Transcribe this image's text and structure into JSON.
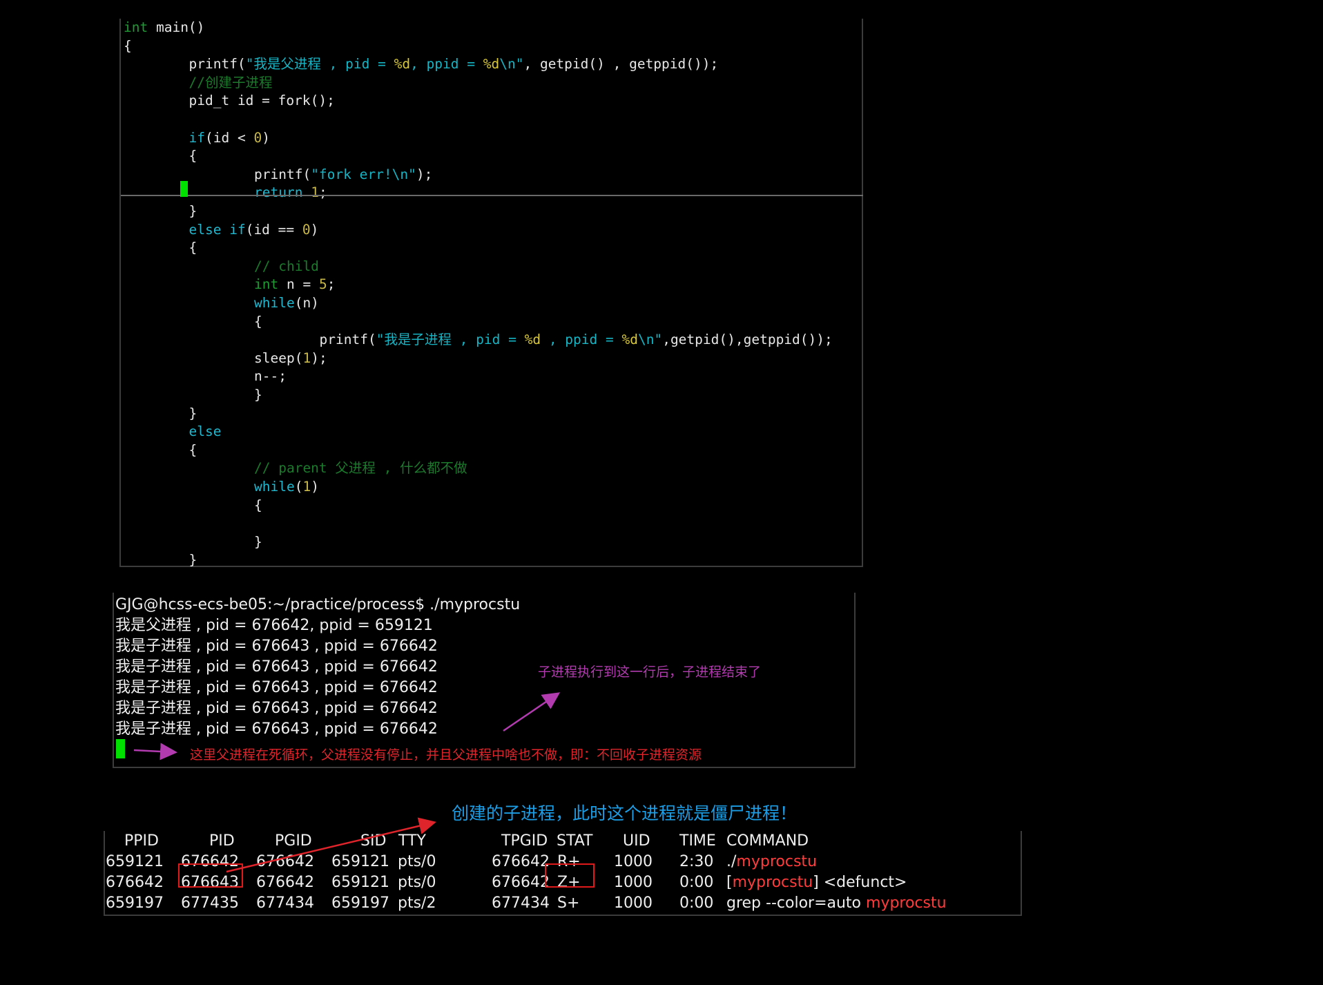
{
  "code": {
    "lines": [
      {
        "indent": 0,
        "tokens": [
          {
            "t": "int",
            "c": "ty"
          },
          {
            "t": " main()",
            "c": ""
          }
        ]
      },
      {
        "indent": 0,
        "tokens": [
          {
            "t": "{",
            "c": ""
          }
        ]
      },
      {
        "indent": 1,
        "tokens": [
          {
            "t": "printf(",
            "c": ""
          },
          {
            "t": "\"我是父进程 , pid = ",
            "c": "str"
          },
          {
            "t": "%d",
            "c": "fmt"
          },
          {
            "t": ", ppid = ",
            "c": "str"
          },
          {
            "t": "%d",
            "c": "fmt"
          },
          {
            "t": "\\n",
            "c": "str"
          },
          {
            "t": "\"",
            "c": "str"
          },
          {
            "t": ", getpid() , getppid());",
            "c": ""
          }
        ]
      },
      {
        "indent": 1,
        "tokens": [
          {
            "t": "//创建子进程",
            "c": "cmt"
          }
        ]
      },
      {
        "indent": 1,
        "tokens": [
          {
            "t": "pid_t id = fork();",
            "c": ""
          }
        ]
      },
      {
        "indent": 0,
        "tokens": []
      },
      {
        "indent": 1,
        "tokens": [
          {
            "t": "if",
            "c": "kw"
          },
          {
            "t": "(id < ",
            "c": ""
          },
          {
            "t": "0",
            "c": "num"
          },
          {
            "t": ")",
            "c": ""
          }
        ]
      },
      {
        "indent": 1,
        "tokens": [
          {
            "t": "{",
            "c": ""
          }
        ]
      },
      {
        "indent": 2,
        "tokens": [
          {
            "t": "printf(",
            "c": ""
          },
          {
            "t": "\"fork err!",
            "c": "str"
          },
          {
            "t": "\\n",
            "c": "str"
          },
          {
            "t": "\"",
            "c": "str"
          },
          {
            "t": ");",
            "c": ""
          }
        ]
      },
      {
        "indent": 2,
        "tokens": [
          {
            "t": "return",
            "c": "kw"
          },
          {
            "t": " ",
            "c": ""
          },
          {
            "t": "1",
            "c": "num"
          },
          {
            "t": ";",
            "c": ""
          }
        ]
      },
      {
        "indent": 1,
        "tokens": [
          {
            "t": "}",
            "c": ""
          }
        ]
      },
      {
        "indent": 1,
        "tokens": [
          {
            "t": "else",
            "c": "kw"
          },
          {
            "t": " ",
            "c": ""
          },
          {
            "t": "if",
            "c": "kw"
          },
          {
            "t": "(id == ",
            "c": ""
          },
          {
            "t": "0",
            "c": "num"
          },
          {
            "t": ")",
            "c": ""
          }
        ]
      },
      {
        "indent": 1,
        "tokens": [
          {
            "t": "{",
            "c": ""
          }
        ]
      },
      {
        "indent": 2,
        "tokens": [
          {
            "t": "// child",
            "c": "cmt"
          }
        ]
      },
      {
        "indent": 2,
        "tokens": [
          {
            "t": "int",
            "c": "ty"
          },
          {
            "t": " n = ",
            "c": ""
          },
          {
            "t": "5",
            "c": "num"
          },
          {
            "t": ";",
            "c": ""
          }
        ]
      },
      {
        "indent": 2,
        "tokens": [
          {
            "t": "while",
            "c": "kw"
          },
          {
            "t": "(n)",
            "c": ""
          }
        ]
      },
      {
        "indent": 2,
        "tokens": [
          {
            "t": "{",
            "c": ""
          }
        ]
      },
      {
        "indent": 3,
        "tokens": [
          {
            "t": "printf(",
            "c": ""
          },
          {
            "t": "\"我是子进程 , pid = ",
            "c": "str"
          },
          {
            "t": "%d",
            "c": "fmt"
          },
          {
            "t": " , ppid = ",
            "c": "str"
          },
          {
            "t": "%d",
            "c": "fmt"
          },
          {
            "t": "\\n",
            "c": "str"
          },
          {
            "t": "\"",
            "c": "str"
          },
          {
            "t": ",getpid(),getppid());",
            "c": ""
          }
        ]
      },
      {
        "indent": 2,
        "tokens": [
          {
            "t": "sleep(",
            "c": ""
          },
          {
            "t": "1",
            "c": "num"
          },
          {
            "t": ");",
            "c": ""
          }
        ]
      },
      {
        "indent": 2,
        "tokens": [
          {
            "t": "n--;",
            "c": ""
          }
        ]
      },
      {
        "indent": 2,
        "tokens": [
          {
            "t": "}",
            "c": ""
          }
        ]
      },
      {
        "indent": 1,
        "tokens": [
          {
            "t": "}",
            "c": ""
          }
        ]
      },
      {
        "indent": 1,
        "tokens": [
          {
            "t": "else",
            "c": "kw"
          }
        ]
      },
      {
        "indent": 1,
        "tokens": [
          {
            "t": "{",
            "c": ""
          }
        ]
      },
      {
        "indent": 2,
        "tokens": [
          {
            "t": "// parent 父进程 , 什么都不做",
            "c": "cmt"
          }
        ]
      },
      {
        "indent": 2,
        "tokens": [
          {
            "t": "while",
            "c": "kw"
          },
          {
            "t": "(",
            "c": ""
          },
          {
            "t": "1",
            "c": "num"
          },
          {
            "t": ")",
            "c": ""
          }
        ]
      },
      {
        "indent": 2,
        "tokens": [
          {
            "t": "{",
            "c": ""
          }
        ]
      },
      {
        "indent": 0,
        "tokens": []
      },
      {
        "indent": 2,
        "tokens": [
          {
            "t": "}",
            "c": ""
          }
        ]
      },
      {
        "indent": 1,
        "tokens": [
          {
            "t": "}",
            "c": ""
          }
        ]
      }
    ]
  },
  "terminal": {
    "lines": [
      "GJG@hcss-ecs-be05:~/practice/process$ ./myprocstu",
      "我是父进程 , pid = 676642, ppid = 659121",
      "我是子进程 , pid = 676643 , ppid = 676642",
      "我是子进程 , pid = 676643 , ppid = 676642",
      "我是子进程 , pid = 676643 , ppid = 676642",
      "我是子进程 , pid = 676643 , ppid = 676642",
      "我是子进程 , pid = 676643 , ppid = 676642"
    ]
  },
  "annotations": {
    "child_end": "子进程执行到这一行后，子进程结束了",
    "parent_loop": "这里父进程在死循环，父进程没有停止，并且父进程中啥也不做，即：不回收子进程资源",
    "zombie": "创建的子进程，此时这个进程就是僵尸进程！"
  },
  "ps": {
    "headers": [
      "PPID",
      "PID",
      "PGID",
      "SID",
      "TTY",
      "TPGID",
      "STAT",
      "UID",
      "TIME",
      "COMMAND"
    ],
    "rows": [
      {
        "ppid": "659121",
        "pid": "676642",
        "pgid": "676642",
        "sid": "659121",
        "tty": "pts/0",
        "tpgid": "676642",
        "stat": "R+",
        "uid": "1000",
        "time": "2:30",
        "cmd_pre": "./",
        "cmd_hl": "myprocstu",
        "cmd_post": ""
      },
      {
        "ppid": "676642",
        "pid": "676643",
        "pgid": "676642",
        "sid": "659121",
        "tty": "pts/0",
        "tpgid": "676642",
        "stat": "Z+",
        "uid": "1000",
        "time": "0:00",
        "cmd_pre": "[",
        "cmd_hl": "myprocstu",
        "cmd_post": "] <defunct>"
      },
      {
        "ppid": "659197",
        "pid": "677435",
        "pgid": "677434",
        "sid": "659197",
        "tty": "pts/2",
        "tpgid": "677434",
        "stat": "S+",
        "uid": "1000",
        "time": "0:00",
        "cmd_pre": "grep --color=auto ",
        "cmd_hl": "myprocstu",
        "cmd_post": ""
      }
    ]
  },
  "colors": {
    "annotation_purple": "#b23bb0",
    "annotation_red": "#e0242b",
    "annotation_blue": "#1c9ee6",
    "cursor_green": "#00e000",
    "highlight_red": "#ff3b3b"
  }
}
